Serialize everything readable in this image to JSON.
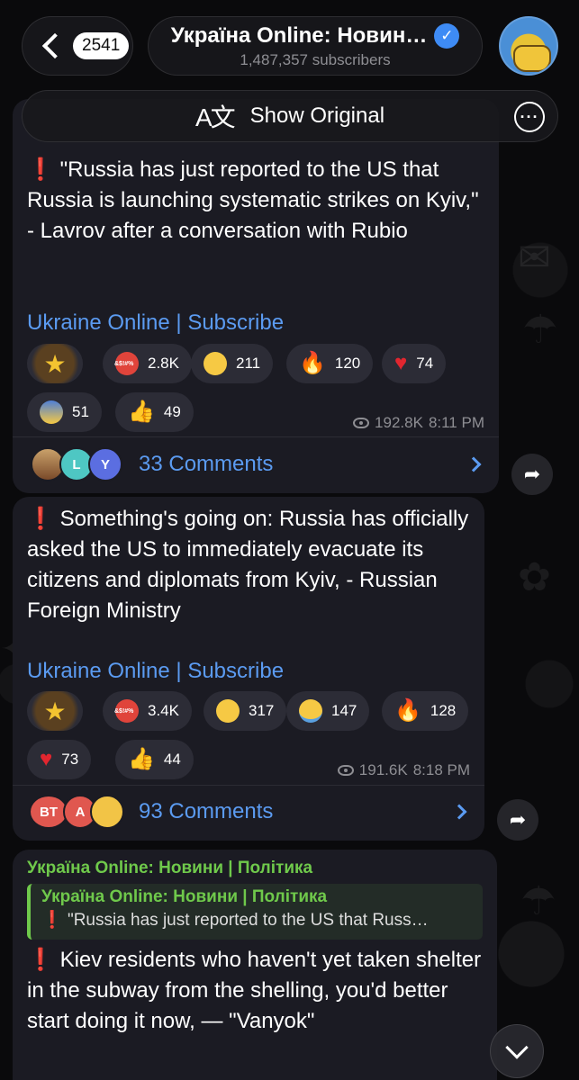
{
  "header": {
    "back_count": "2541",
    "channel_title": "Україна Online: Новин…",
    "subscribers": "1,487,357 subscribers",
    "verified_icon": "verified-badge-icon"
  },
  "translate_bar": {
    "label": "Show Original",
    "icon": "translate-icon"
  },
  "messages": [
    {
      "text": "\"Russia has just reported to the US that Russia is launching systematic strikes on Kyiv,\" - Lavrov after a conversation with Rubio",
      "link": "Ukraine Online | Subscribe",
      "reactions": [
        {
          "emoji": "star",
          "count": ""
        },
        {
          "emoji": "swearing-face",
          "count": "2.8K"
        },
        {
          "emoji": "grinning-face",
          "count": "211"
        },
        {
          "emoji": "fire",
          "count": "120"
        },
        {
          "emoji": "heart",
          "count": "74"
        },
        {
          "emoji": "screaming-face",
          "count": "51"
        },
        {
          "emoji": "thumbs-up",
          "count": "49"
        }
      ],
      "views": "192.8K",
      "time": "8:11 PM",
      "comments": "33 Comments",
      "commenter_initials": [
        "",
        "L",
        "Y"
      ]
    },
    {
      "text": "Something's going on: Russia has officially asked the US to immediately evacuate its citizens and diplomats from Kyiv, - Russian Foreign Ministry",
      "link": "Ukraine Online | Subscribe",
      "reactions": [
        {
          "emoji": "star",
          "count": ""
        },
        {
          "emoji": "swearing-face",
          "count": "3.4K"
        },
        {
          "emoji": "grinning-face",
          "count": "317"
        },
        {
          "emoji": "crying-face",
          "count": "147"
        },
        {
          "emoji": "fire",
          "count": "128"
        },
        {
          "emoji": "heart",
          "count": "73"
        },
        {
          "emoji": "thumbs-up",
          "count": "44"
        }
      ],
      "views": "191.6K",
      "time": "8:18 PM",
      "comments": "93 Comments",
      "commenter_initials": [
        "BT",
        "A",
        ""
      ]
    },
    {
      "forward_header": "Україна Online: Новини | Політика",
      "quote_title": "Україна Online: Новини | Політика",
      "quote_text": "\"Russia has just reported to the US that Russ…",
      "text": "Kiev residents who haven't yet taken shelter in the subway from the shelling, you'd better start doing it now, — \"Vanyok\""
    }
  ],
  "colors": {
    "accent_link": "#5b9bf1",
    "forward_green": "#6fc94b",
    "exclamation_red": "#e0342b",
    "bubble_bg": "#1b1b23"
  }
}
